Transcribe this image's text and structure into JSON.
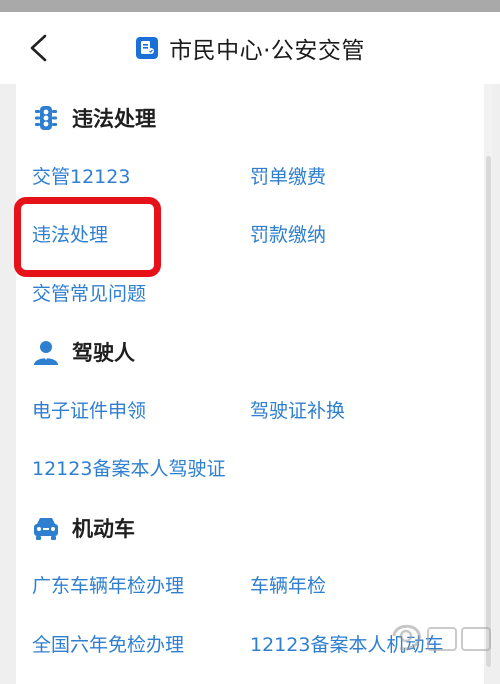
{
  "header": {
    "title": "市民中心·公安交管"
  },
  "sections": [
    {
      "title": "违法处理",
      "icon": "traffic-light-icon",
      "items": [
        "交管12123",
        "罚单缴费",
        "违法处理",
        "罚款缴纳",
        "交管常见问题"
      ]
    },
    {
      "title": "驾驶人",
      "icon": "driver-person-icon",
      "items": [
        "电子证件申领",
        "驾驶证补换",
        "12123备案本人驾驶证"
      ]
    },
    {
      "title": "机动车",
      "icon": "car-icon",
      "items": [
        "广东车辆年检办理",
        "车辆年检",
        "全国六年免检办理",
        "12123备案本人机动车"
      ]
    }
  ],
  "colors": {
    "accent": "#2f7fd1",
    "highlight": "#e6121a",
    "section_icon": "#2f7fd1"
  },
  "watermark": {
    "icon": "baidu-jingyan-watermark-icon"
  }
}
